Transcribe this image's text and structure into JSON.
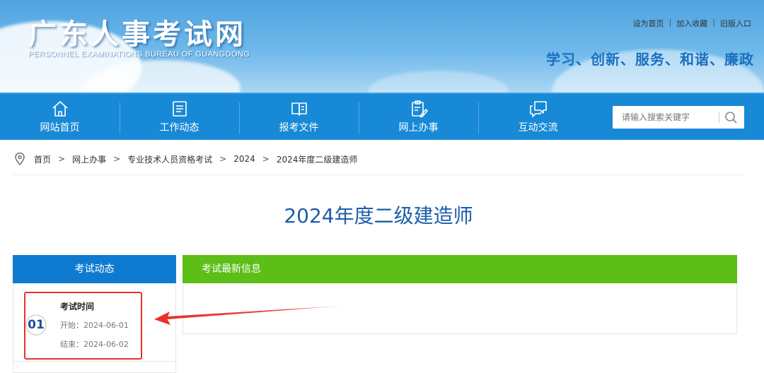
{
  "header": {
    "logo_cn": "广东人事考试网",
    "logo_en": "PERSONNEL EXAMINATIONS BUREAU OF GUANGDONG",
    "top_links": [
      "设为首页",
      "加入收藏",
      "旧版入口"
    ],
    "top_link_sep": "|",
    "slogan": "学习、创新、服务、和谐、廉政"
  },
  "nav": {
    "items": [
      {
        "label": "网站首页",
        "icon": "home-icon"
      },
      {
        "label": "工作动态",
        "icon": "news-list-icon"
      },
      {
        "label": "报考文件",
        "icon": "open-book-icon"
      },
      {
        "label": "网上办事",
        "icon": "clipboard-edit-icon"
      },
      {
        "label": "互动交流",
        "icon": "chat-bubbles-icon"
      }
    ],
    "search_placeholder": "请输入搜索关键字",
    "search_icon": "search-icon"
  },
  "breadcrumb": {
    "icon": "location-pin-icon",
    "sep": ">",
    "items": [
      "首页",
      "网上办事",
      "专业技术人员资格考试",
      "2024",
      "2024年度二级建造师"
    ]
  },
  "page_title": "2024年度二级建造师",
  "left_panel": {
    "title": "考试动态",
    "event": {
      "number": "01",
      "title": "考试时间",
      "start": "开始：2024-06-01",
      "end": "结束：2024-06-02"
    }
  },
  "right_panel": {
    "title": "考试最新信息"
  },
  "colors": {
    "nav_blue": "#1889d6",
    "left_head_blue": "#0f7bd0",
    "right_head_green": "#5cbe16",
    "title_blue": "#1c5da8",
    "highlight_red": "#e8302a"
  }
}
